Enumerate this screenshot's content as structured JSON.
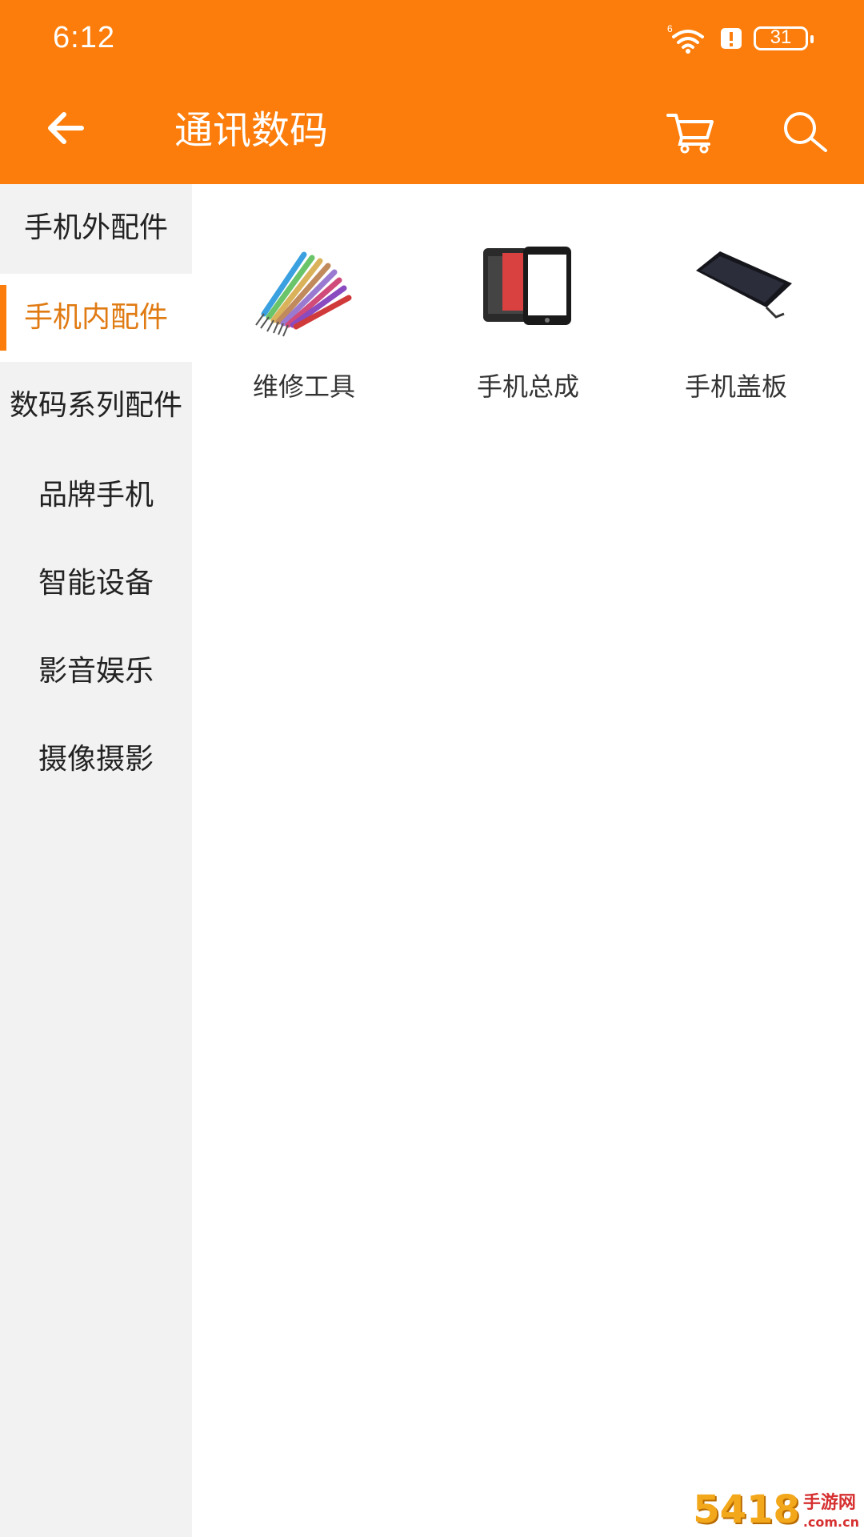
{
  "status_bar": {
    "time": "6:12",
    "battery": "31",
    "network_badge": "6"
  },
  "header": {
    "title": "通讯数码",
    "back_icon": "arrow-left-icon",
    "cart_icon": "cart-icon",
    "search_icon": "search-icon",
    "accent_color": "#fc7d0b"
  },
  "sidebar": {
    "items": [
      {
        "label": "手机外配件",
        "selected": false
      },
      {
        "label": "手机内配件",
        "selected": true
      },
      {
        "label": "数码系列配件",
        "selected": false
      },
      {
        "label": "品牌手机",
        "selected": false
      },
      {
        "label": "智能设备",
        "selected": false
      },
      {
        "label": "影音娱乐",
        "selected": false
      },
      {
        "label": "摄像摄影",
        "selected": false
      }
    ]
  },
  "categories": [
    {
      "label": "维修工具",
      "image": "screwdriver-set-image"
    },
    {
      "label": "手机总成",
      "image": "phone-assembly-image"
    },
    {
      "label": "手机盖板",
      "image": "phone-cover-image"
    }
  ],
  "watermark": {
    "number": "5418",
    "text_top": "手游网",
    "text_bottom": ".com.cn"
  }
}
